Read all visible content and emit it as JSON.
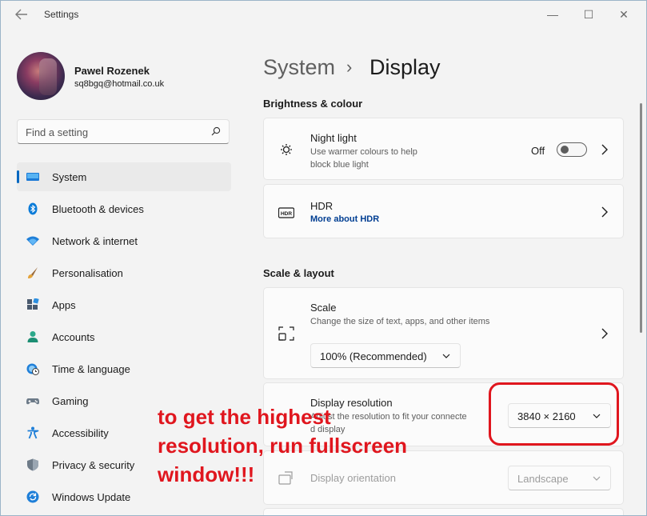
{
  "window": {
    "title": "Settings",
    "controls": {
      "minimize": "—",
      "maximize": "☐",
      "close": "✕"
    }
  },
  "user": {
    "name": "Pawel Rozenek",
    "email": "sq8bgq@hotmail.co.uk"
  },
  "search": {
    "placeholder": "Find a setting"
  },
  "nav": {
    "items": [
      {
        "label": "System",
        "icon": "monitor-icon",
        "active": true
      },
      {
        "label": "Bluetooth & devices",
        "icon": "bluetooth-icon"
      },
      {
        "label": "Network & internet",
        "icon": "wifi-icon"
      },
      {
        "label": "Personalisation",
        "icon": "brush-icon"
      },
      {
        "label": "Apps",
        "icon": "apps-icon"
      },
      {
        "label": "Accounts",
        "icon": "person-icon"
      },
      {
        "label": "Time & language",
        "icon": "globe-clock-icon"
      },
      {
        "label": "Gaming",
        "icon": "gamepad-icon"
      },
      {
        "label": "Accessibility",
        "icon": "accessibility-icon"
      },
      {
        "label": "Privacy & security",
        "icon": "shield-icon"
      },
      {
        "label": "Windows Update",
        "icon": "update-icon"
      }
    ]
  },
  "breadcrumb": {
    "parent": "System",
    "separator": "›",
    "current": "Display"
  },
  "sections": {
    "brightness": {
      "title": "Brightness & colour",
      "night_light": {
        "title": "Night light",
        "desc_line1": "Use warmer colours to help",
        "desc_line2": "block blue light",
        "state_label": "Off"
      },
      "hdr": {
        "title": "HDR",
        "link": "More about HDR"
      }
    },
    "scale_layout": {
      "title": "Scale & layout",
      "scale": {
        "title": "Scale",
        "desc": "Change the size of text, apps, and other items",
        "value": "100% (Recommended)"
      },
      "resolution": {
        "title": "Display resolution",
        "desc_line1": "Adjust the resolution to fit your connecte",
        "desc_line2": "d display",
        "value": "3840 × 2160"
      },
      "orientation": {
        "title": "Display orientation",
        "value": "Landscape"
      }
    }
  },
  "annotation": {
    "line1": "to get the highest",
    "line2": "resolution, run fullscreen",
    "line3": "window!!!",
    "color": "#e0161e"
  },
  "colors": {
    "accent": "#0067c0",
    "link": "#003e92"
  }
}
